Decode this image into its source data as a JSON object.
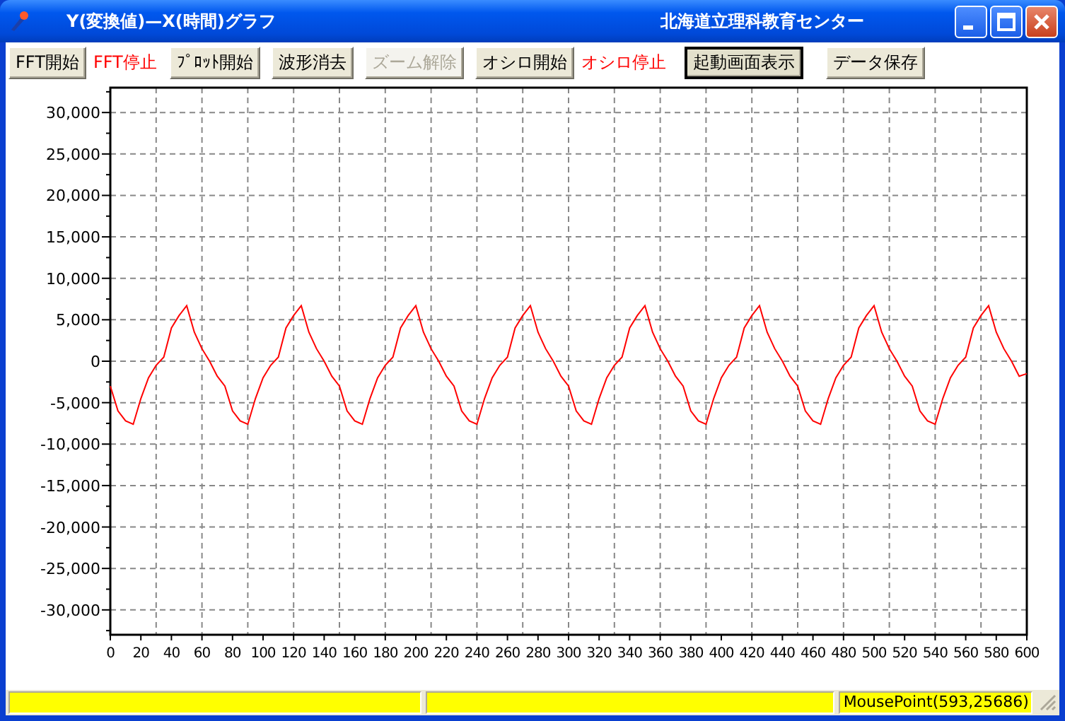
{
  "window": {
    "title": "Y(変換値)—X(時間)グラフ",
    "organization": "北海道立理科教育センター"
  },
  "toolbar": [
    {
      "kind": "button",
      "label": "FFT開始",
      "disabled": false,
      "focused": false
    },
    {
      "kind": "status",
      "label": "FFT停止"
    },
    {
      "kind": "button",
      "label": "ﾌﾟﾛｯﾄ開始",
      "disabled": false,
      "focused": false
    },
    {
      "kind": "button",
      "label": "波形消去",
      "disabled": false,
      "focused": false
    },
    {
      "kind": "button",
      "label": "ズーム解除",
      "disabled": true,
      "focused": false
    },
    {
      "kind": "button",
      "label": "オシロ開始",
      "disabled": false,
      "focused": false
    },
    {
      "kind": "status",
      "label": "オシロ停止"
    },
    {
      "kind": "button",
      "label": "起動画面表示",
      "disabled": false,
      "focused": true
    },
    {
      "kind": "button",
      "label": "データ保存",
      "disabled": false,
      "focused": false
    }
  ],
  "chart": {
    "chart_data": {
      "type": "line",
      "grid": true,
      "xlim": [
        0,
        600
      ],
      "ylim": [
        -33000,
        33000
      ],
      "xticks": [
        0,
        20,
        40,
        60,
        80,
        100,
        120,
        140,
        160,
        180,
        200,
        220,
        240,
        260,
        280,
        300,
        320,
        340,
        360,
        380,
        400,
        420,
        440,
        460,
        480,
        500,
        520,
        540,
        560,
        580,
        600
      ],
      "yticks": [
        {
          "value": 30000,
          "label": "30,000"
        },
        {
          "value": 25000,
          "label": "25,000"
        },
        {
          "value": 20000,
          "label": "20,000"
        },
        {
          "value": 15000,
          "label": "15,000"
        },
        {
          "value": 10000,
          "label": "10,000"
        },
        {
          "value": 5000,
          "label": "5,000"
        },
        {
          "value": 0,
          "label": "0"
        },
        {
          "value": -5000,
          "label": "-5,000"
        },
        {
          "value": -10000,
          "label": "-10,000"
        },
        {
          "value": -15000,
          "label": "-15,000"
        },
        {
          "value": -20000,
          "label": "-20,000"
        },
        {
          "value": -25000,
          "label": "-25,000"
        },
        {
          "value": -30000,
          "label": "-30,000"
        }
      ],
      "x": [
        0,
        5,
        10,
        15,
        20,
        25,
        30,
        35,
        40,
        45,
        50,
        55,
        60,
        65,
        70,
        75,
        80,
        85,
        90,
        95,
        100,
        105,
        110,
        115,
        120,
        125,
        130,
        135,
        140,
        145,
        150,
        155,
        160,
        165,
        170,
        175,
        180,
        185,
        190,
        195,
        200,
        205,
        210,
        215,
        220,
        225,
        230,
        235,
        240,
        245,
        250,
        255,
        260,
        265,
        270,
        275,
        280,
        285,
        290,
        295,
        300,
        305,
        310,
        315,
        320,
        325,
        330,
        335,
        340,
        345,
        350,
        355,
        360,
        365,
        370,
        375,
        380,
        385,
        390,
        395,
        400,
        405,
        410,
        415,
        420,
        425,
        430,
        435,
        440,
        445,
        450,
        455,
        460,
        465,
        470,
        475,
        480,
        485,
        490,
        495,
        500,
        505,
        510,
        515,
        520,
        525,
        530,
        535,
        540,
        545,
        550,
        555,
        560,
        565,
        570,
        575,
        580,
        585,
        590,
        595,
        600
      ],
      "series": [
        {
          "color": "#ff0000",
          "values": [
            -3000,
            -6000,
            -7200,
            -7600,
            -4500,
            -2000,
            -500,
            500,
            4000,
            5500,
            6700,
            3500,
            1500,
            0,
            -1800,
            -3000,
            -6000,
            -7200,
            -7600,
            -4500,
            -2000,
            -500,
            500,
            4000,
            5500,
            6700,
            3500,
            1500,
            0,
            -1800,
            -3000,
            -6000,
            -7200,
            -7600,
            -4500,
            -2000,
            -500,
            500,
            4000,
            5500,
            6700,
            3500,
            1500,
            0,
            -1800,
            -3000,
            -6000,
            -7200,
            -7600,
            -4500,
            -2000,
            -500,
            500,
            4000,
            5500,
            6700,
            3500,
            1500,
            0,
            -1800,
            -3000,
            -6000,
            -7200,
            -7600,
            -4500,
            -2000,
            -500,
            500,
            4000,
            5500,
            6700,
            3500,
            1500,
            0,
            -1800,
            -3000,
            -6000,
            -7200,
            -7600,
            -4500,
            -2000,
            -500,
            500,
            4000,
            5500,
            6700,
            3500,
            1500,
            0,
            -1800,
            -3000,
            -6000,
            -7200,
            -7600,
            -4500,
            -2000,
            -500,
            500,
            4000,
            5500,
            6700,
            3500,
            1500,
            0,
            -1800,
            -3000,
            -6000,
            -7200,
            -7600,
            -4500,
            -2000,
            -500,
            500,
            4000,
            5500,
            6700,
            3500,
            1500,
            0,
            -1800,
            -1500
          ]
        }
      ]
    }
  },
  "status_bar": {
    "mouse_point": "MousePoint(593,25686)"
  }
}
